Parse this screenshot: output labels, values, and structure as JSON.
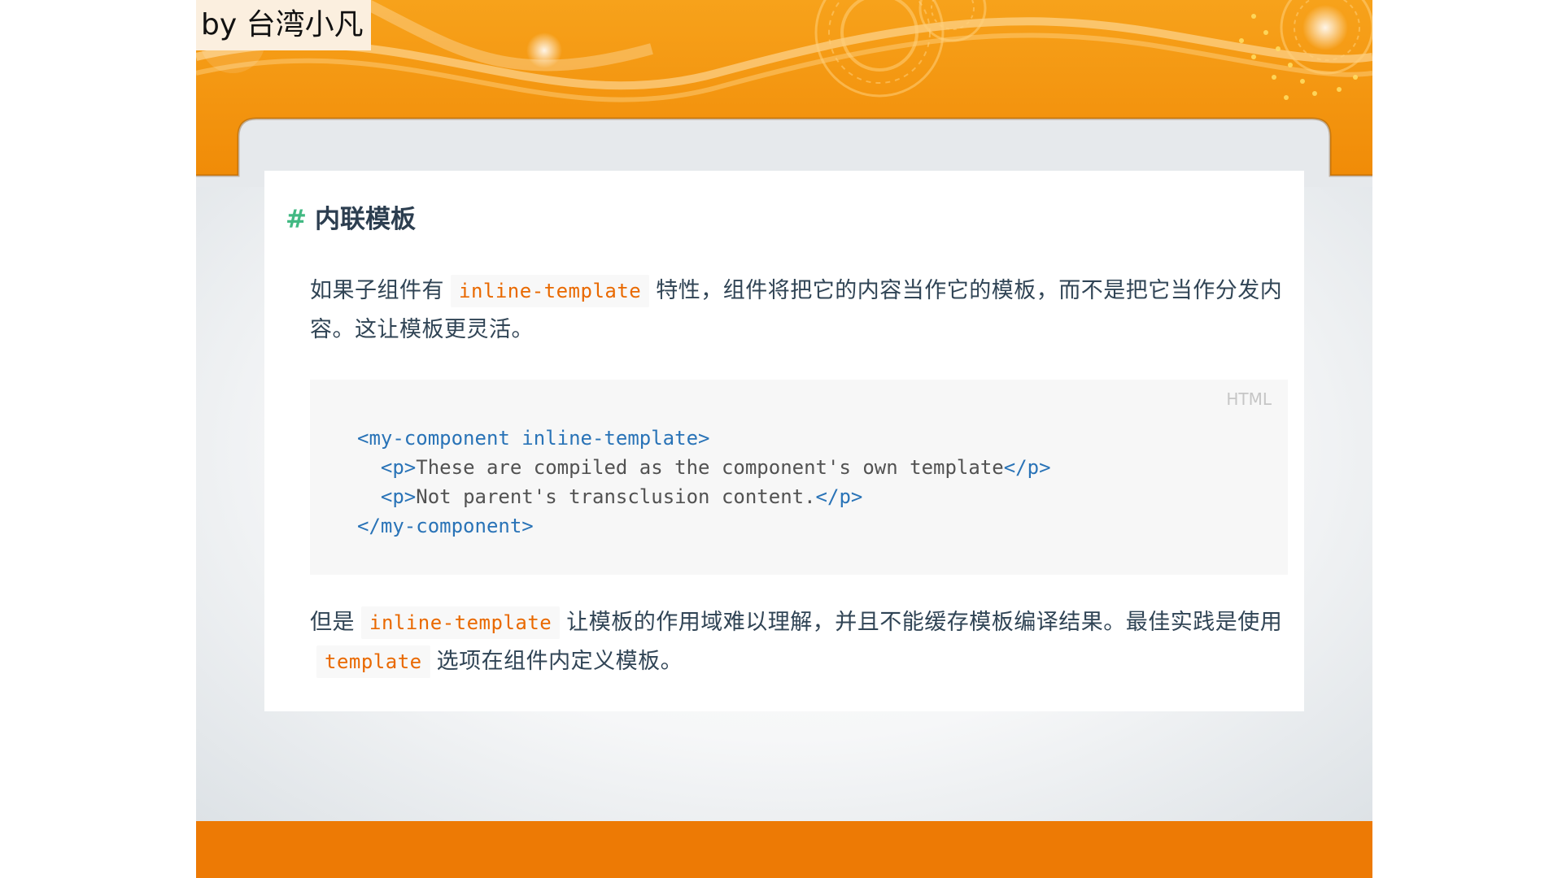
{
  "author_label": "by 台湾小凡",
  "section": {
    "hash": "#",
    "title": "内联模板"
  },
  "paragraph1": {
    "before": "如果子组件有",
    "code": "inline-template",
    "after": "特性，组件将把它的内容当作它的模板，而不是把它当作分发内容。这让模板更灵活。"
  },
  "codeblock": {
    "language": "HTML",
    "lines": {
      "l1_open": "<my-component inline-template>",
      "l2_open": "<p>",
      "l2_text": "These are compiled as the component's own template",
      "l2_close": "</p>",
      "l3_open": "<p>",
      "l3_text": "Not parent's transclusion content.",
      "l3_close": "</p>",
      "l4_close": "</my-component>"
    }
  },
  "paragraph2": {
    "before": "但是",
    "code1": "inline-template",
    "middle": "让模板的作用域难以理解，并且不能缓存模板编译结果。最佳实践是使用",
    "code2": "template",
    "after": "选项在组件内定义模板。"
  },
  "colors": {
    "banner_orange": "#f39c12",
    "footer_orange": "#ed7a05",
    "hash_green": "#42b983",
    "code_orange": "#e96900",
    "tag_blue": "#2973b7"
  }
}
